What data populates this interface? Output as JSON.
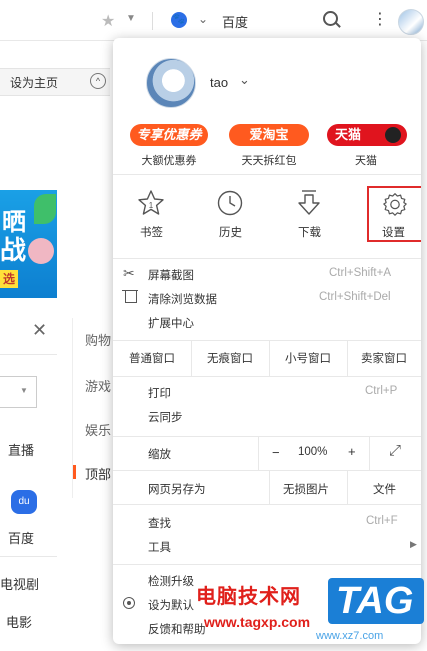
{
  "toolbar": {
    "search_engine": "百度"
  },
  "bookmarks_bar": {
    "set_home": "设为主页"
  },
  "page": {
    "banner_title": "晒",
    "banner_sub": "战",
    "banner_btn": "选",
    "live": "直播",
    "baidu": "百度",
    "tv": "电视剧",
    "movie": "电影",
    "right_cats": [
      "购物",
      "游戏",
      "娱乐",
      "顶部"
    ]
  },
  "menu": {
    "username": "tao",
    "promos": [
      {
        "badge": "专享优惠券",
        "label": "大额优惠券",
        "color": "#ff5a1f"
      },
      {
        "badge": "爱淘宝",
        "label": "天天拆红包",
        "color": "#ff5a1f"
      },
      {
        "badge": "天猫",
        "label": "天猫",
        "color": "#e0141e"
      }
    ],
    "tools": [
      {
        "label": "书签",
        "icon": "star-outline-icon"
      },
      {
        "label": "历史",
        "icon": "clock-icon"
      },
      {
        "label": "下载",
        "icon": "download-icon"
      },
      {
        "label": "设置",
        "icon": "gear-icon"
      }
    ],
    "screenshot": "屏幕截图",
    "screenshot_key": "Ctrl+Shift+A",
    "clear": "清除浏览数据",
    "clear_key": "Ctrl+Shift+Del",
    "extensions": "扩展中心",
    "windows": [
      "普通窗口",
      "无痕窗口",
      "小号窗口",
      "卖家窗口"
    ],
    "print": "打印",
    "print_key": "Ctrl+P",
    "sync": "云同步",
    "zoom": "缩放",
    "zoom_minus": "−",
    "zoom_value": "100%",
    "zoom_plus": "+",
    "saveas": "网页另存为",
    "no_images": "无损图片",
    "file": "文件",
    "find": "查找",
    "find_key": "Ctrl+F",
    "tools_label": "工具",
    "check_update": "检测升级",
    "set_default": "设为默认",
    "feedback": "反馈和帮助"
  },
  "watermark": {
    "text1": "电脑技术网",
    "url": "www.tagxp.com",
    "logo": "TAG",
    "site2": "www.xz7.com"
  }
}
